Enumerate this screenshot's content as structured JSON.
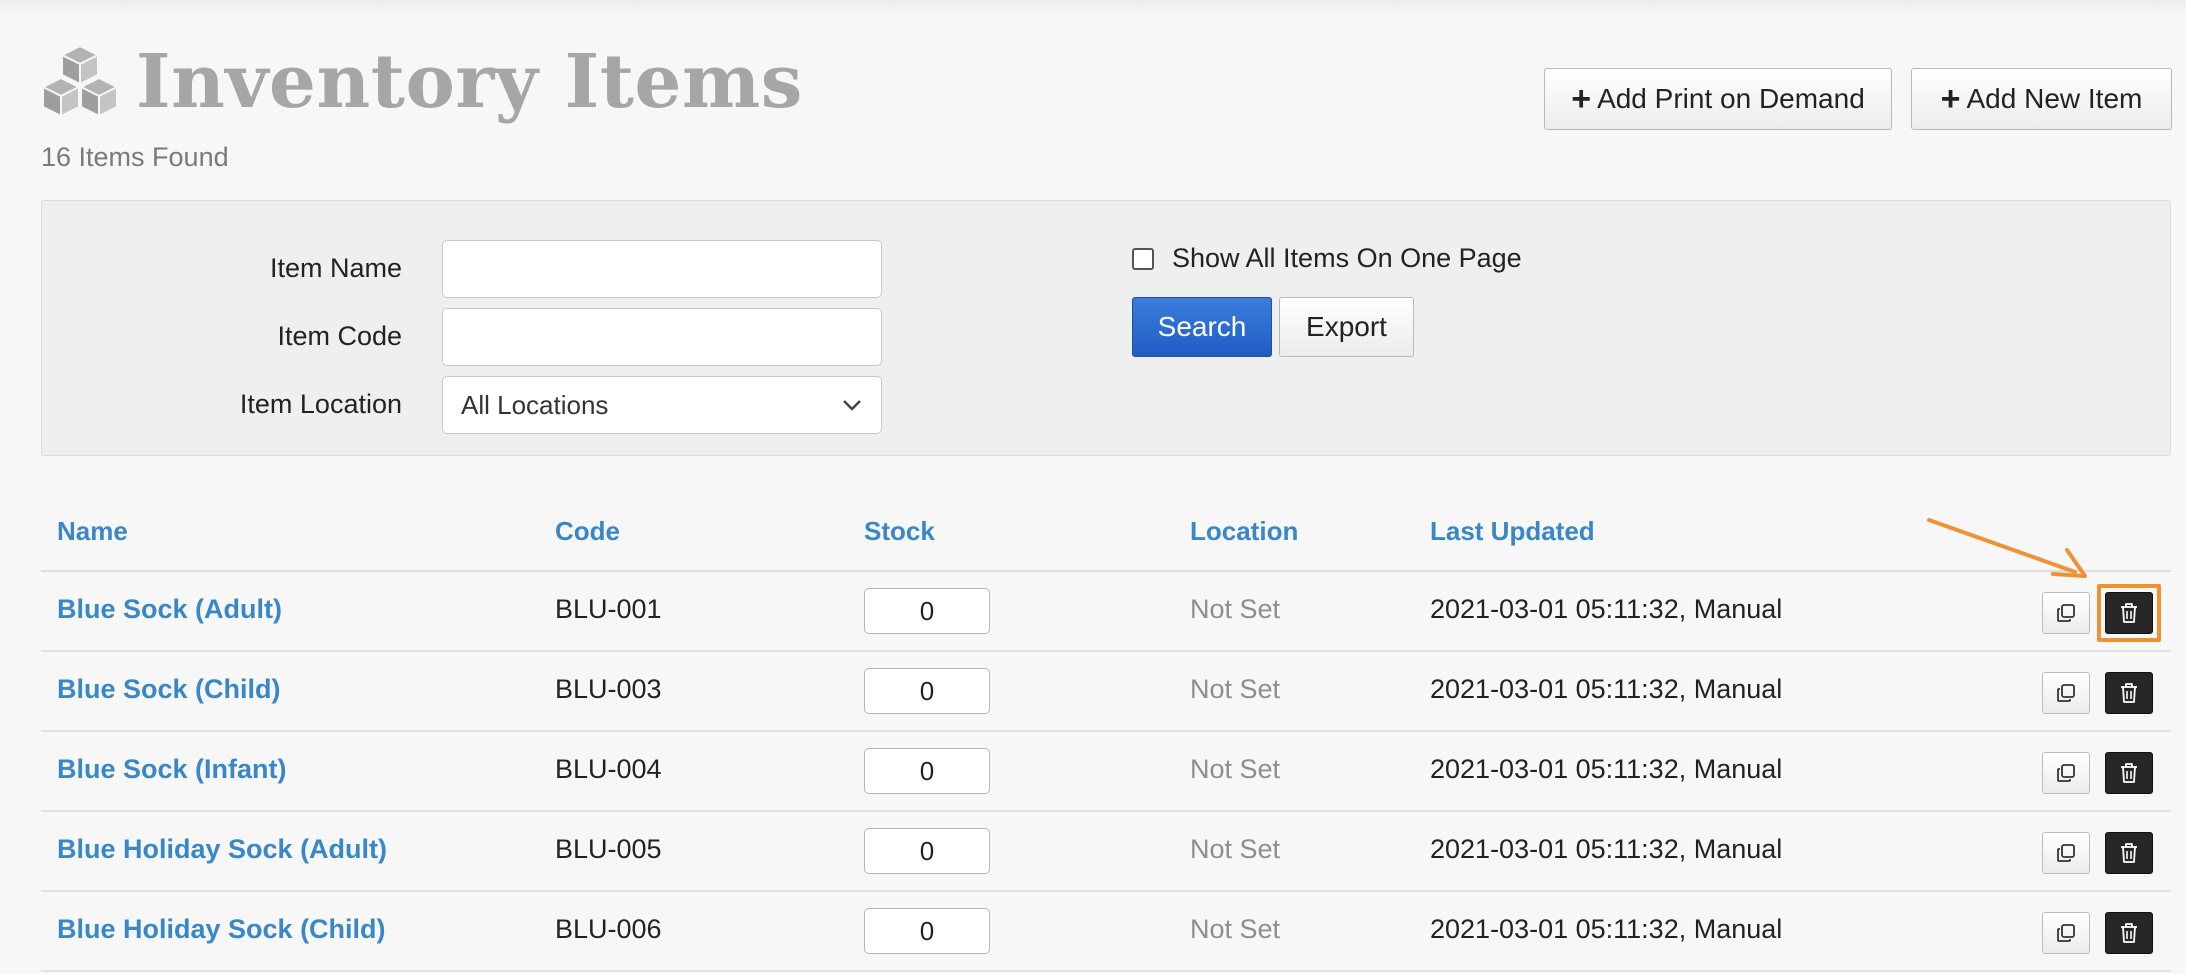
{
  "header": {
    "title": "Inventory Items",
    "items_found": "16 Items Found",
    "add_print_on_demand": "Add Print on Demand",
    "add_new_item": "Add New Item",
    "icon": "cubes-icon"
  },
  "filters": {
    "item_name_label": "Item Name",
    "item_name_value": "",
    "item_code_label": "Item Code",
    "item_code_value": "",
    "item_location_label": "Item Location",
    "item_location_selected": "All Locations",
    "show_all_label": "Show All Items On One Page",
    "show_all_checked": false,
    "search_label": "Search",
    "export_label": "Export"
  },
  "table": {
    "columns": [
      "Name",
      "Code",
      "Stock",
      "Location",
      "Last Updated"
    ],
    "rows": [
      {
        "name": "Blue Sock (Adult)",
        "code": "BLU-001",
        "stock": "0",
        "location": "Not Set",
        "updated": "2021-03-01 05:11:32, Manual"
      },
      {
        "name": "Blue Sock (Child)",
        "code": "BLU-003",
        "stock": "0",
        "location": "Not Set",
        "updated": "2021-03-01 05:11:32, Manual"
      },
      {
        "name": "Blue Sock (Infant)",
        "code": "BLU-004",
        "stock": "0",
        "location": "Not Set",
        "updated": "2021-03-01 05:11:32, Manual"
      },
      {
        "name": "Blue Holiday Sock (Adult)",
        "code": "BLU-005",
        "stock": "0",
        "location": "Not Set",
        "updated": "2021-03-01 05:11:32, Manual"
      },
      {
        "name": "Blue Holiday Sock (Child)",
        "code": "BLU-006",
        "stock": "0",
        "location": "Not Set",
        "updated": "2021-03-01 05:11:32, Manual"
      }
    ]
  },
  "colors": {
    "link_blue": "#3a87c8",
    "search_button": "#2a6ad0",
    "highlight_orange": "#ef9233",
    "title_gray": "#a6a6a6"
  }
}
